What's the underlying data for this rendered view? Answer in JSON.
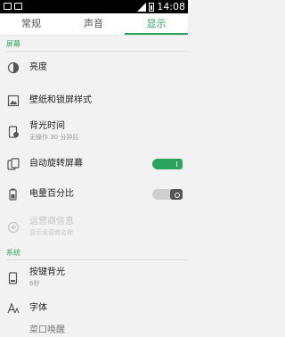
{
  "status_bar": {
    "time": "14:08"
  },
  "tabs": [
    {
      "label": "常规",
      "active": false
    },
    {
      "label": "声音",
      "active": false
    },
    {
      "label": "显示",
      "active": true
    }
  ],
  "sections": {
    "screen": "屏幕",
    "system": "系统"
  },
  "rows": {
    "brightness": {
      "title": "亮度",
      "icon": "brightness-icon"
    },
    "wallpaper": {
      "title": "壁纸和锁屏样式",
      "icon": "wallpaper-icon"
    },
    "backlight": {
      "title": "背光时间",
      "subtitle": "无操作 30 分钟后",
      "icon": "phone-timer-icon"
    },
    "auto_rotate": {
      "title": "自动旋转屏幕",
      "icon": "rotate-screen-icon",
      "toggle": "on"
    },
    "battery_percent": {
      "title": "电量百分比",
      "icon": "battery-icon",
      "toggle": "off"
    },
    "carrier_info": {
      "title": "运营商信息",
      "subtitle": "显示运营商名称",
      "icon": "carrier-icon",
      "disabled": true
    },
    "key_backlight": {
      "title": "按键背光",
      "subtitle": "6秒",
      "icon": "key-backlight-icon"
    },
    "font": {
      "title": "字体",
      "icon": "font-icon"
    },
    "partial": {
      "title": "菜口唤醒"
    }
  },
  "colors": {
    "accent": "#2aa35e"
  }
}
